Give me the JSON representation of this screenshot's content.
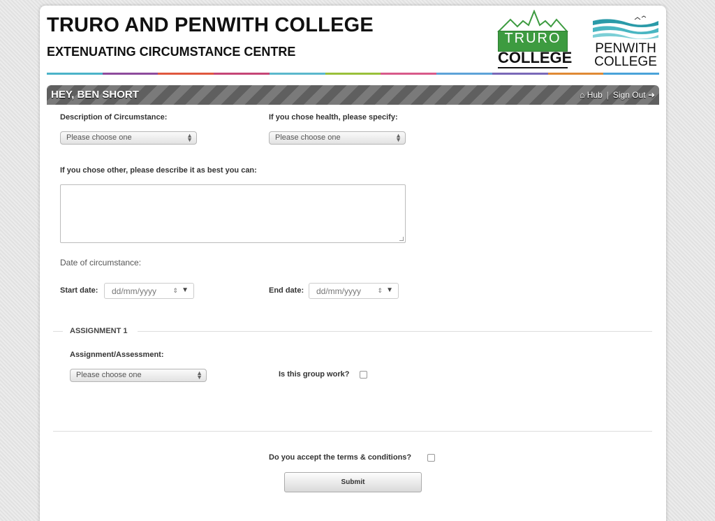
{
  "header": {
    "title": "TRURO AND PENWITH COLLEGE",
    "subtitle": "EXTENUATING CIRCUMSTANCE CENTRE",
    "logo_truro_top": "TRURO",
    "logo_truro_bottom": "COLLEGE",
    "logo_penwith_top": "PENWITH",
    "logo_penwith_bottom": "COLLEGE",
    "stripe_colors": [
      "#4bb3c9",
      "#8e4b9c",
      "#e0573f",
      "#c64677",
      "#5bb8cc",
      "#9ac03b",
      "#d85a8a",
      "#5ea3d8",
      "#7a69b8",
      "#e08a35",
      "#4aa3d9"
    ]
  },
  "userbar": {
    "greeting": "HEY, BEN SHORT",
    "hub_label": "Hub",
    "separator": "|",
    "signout_label": "Sign Out"
  },
  "form": {
    "description_label": "Description of Circumstance:",
    "description_value": "Please choose one",
    "health_label": "If you chose health, please specify:",
    "health_value": "Please choose one",
    "other_label": "If you chose other, please describe it as best you can:",
    "date_heading": "Date of circumstance:",
    "start_label": "Start date:",
    "start_value": "dd/mm/yyyy",
    "end_label": "End date:",
    "end_value": "dd/mm/yyyy",
    "assignment_legend": "ASSIGNMENT 1",
    "assignment_label": "Assignment/Assessment:",
    "assignment_value": "Please choose one",
    "group_work_label": "Is this group work?",
    "terms_label": "Do you accept the terms & conditions?",
    "submit_label": "Submit"
  }
}
